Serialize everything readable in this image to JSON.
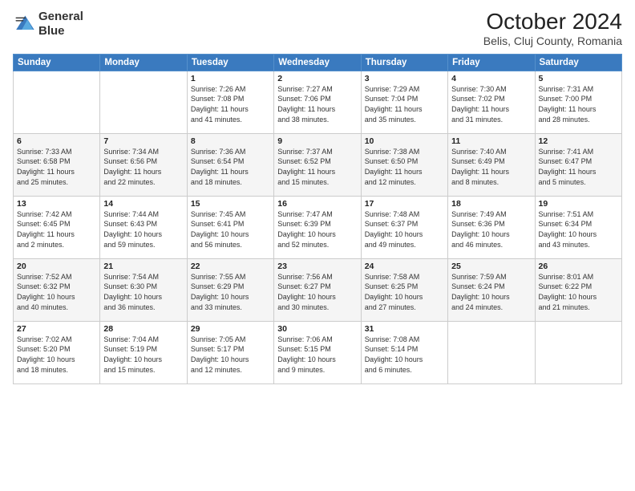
{
  "header": {
    "logo_line1": "General",
    "logo_line2": "Blue",
    "title": "October 2024",
    "subtitle": "Belis, Cluj County, Romania"
  },
  "weekdays": [
    "Sunday",
    "Monday",
    "Tuesday",
    "Wednesday",
    "Thursday",
    "Friday",
    "Saturday"
  ],
  "rows": [
    [
      {
        "num": "",
        "info": ""
      },
      {
        "num": "",
        "info": ""
      },
      {
        "num": "1",
        "info": "Sunrise: 7:26 AM\nSunset: 7:08 PM\nDaylight: 11 hours\nand 41 minutes."
      },
      {
        "num": "2",
        "info": "Sunrise: 7:27 AM\nSunset: 7:06 PM\nDaylight: 11 hours\nand 38 minutes."
      },
      {
        "num": "3",
        "info": "Sunrise: 7:29 AM\nSunset: 7:04 PM\nDaylight: 11 hours\nand 35 minutes."
      },
      {
        "num": "4",
        "info": "Sunrise: 7:30 AM\nSunset: 7:02 PM\nDaylight: 11 hours\nand 31 minutes."
      },
      {
        "num": "5",
        "info": "Sunrise: 7:31 AM\nSunset: 7:00 PM\nDaylight: 11 hours\nand 28 minutes."
      }
    ],
    [
      {
        "num": "6",
        "info": "Sunrise: 7:33 AM\nSunset: 6:58 PM\nDaylight: 11 hours\nand 25 minutes."
      },
      {
        "num": "7",
        "info": "Sunrise: 7:34 AM\nSunset: 6:56 PM\nDaylight: 11 hours\nand 22 minutes."
      },
      {
        "num": "8",
        "info": "Sunrise: 7:36 AM\nSunset: 6:54 PM\nDaylight: 11 hours\nand 18 minutes."
      },
      {
        "num": "9",
        "info": "Sunrise: 7:37 AM\nSunset: 6:52 PM\nDaylight: 11 hours\nand 15 minutes."
      },
      {
        "num": "10",
        "info": "Sunrise: 7:38 AM\nSunset: 6:50 PM\nDaylight: 11 hours\nand 12 minutes."
      },
      {
        "num": "11",
        "info": "Sunrise: 7:40 AM\nSunset: 6:49 PM\nDaylight: 11 hours\nand 8 minutes."
      },
      {
        "num": "12",
        "info": "Sunrise: 7:41 AM\nSunset: 6:47 PM\nDaylight: 11 hours\nand 5 minutes."
      }
    ],
    [
      {
        "num": "13",
        "info": "Sunrise: 7:42 AM\nSunset: 6:45 PM\nDaylight: 11 hours\nand 2 minutes."
      },
      {
        "num": "14",
        "info": "Sunrise: 7:44 AM\nSunset: 6:43 PM\nDaylight: 10 hours\nand 59 minutes."
      },
      {
        "num": "15",
        "info": "Sunrise: 7:45 AM\nSunset: 6:41 PM\nDaylight: 10 hours\nand 56 minutes."
      },
      {
        "num": "16",
        "info": "Sunrise: 7:47 AM\nSunset: 6:39 PM\nDaylight: 10 hours\nand 52 minutes."
      },
      {
        "num": "17",
        "info": "Sunrise: 7:48 AM\nSunset: 6:37 PM\nDaylight: 10 hours\nand 49 minutes."
      },
      {
        "num": "18",
        "info": "Sunrise: 7:49 AM\nSunset: 6:36 PM\nDaylight: 10 hours\nand 46 minutes."
      },
      {
        "num": "19",
        "info": "Sunrise: 7:51 AM\nSunset: 6:34 PM\nDaylight: 10 hours\nand 43 minutes."
      }
    ],
    [
      {
        "num": "20",
        "info": "Sunrise: 7:52 AM\nSunset: 6:32 PM\nDaylight: 10 hours\nand 40 minutes."
      },
      {
        "num": "21",
        "info": "Sunrise: 7:54 AM\nSunset: 6:30 PM\nDaylight: 10 hours\nand 36 minutes."
      },
      {
        "num": "22",
        "info": "Sunrise: 7:55 AM\nSunset: 6:29 PM\nDaylight: 10 hours\nand 33 minutes."
      },
      {
        "num": "23",
        "info": "Sunrise: 7:56 AM\nSunset: 6:27 PM\nDaylight: 10 hours\nand 30 minutes."
      },
      {
        "num": "24",
        "info": "Sunrise: 7:58 AM\nSunset: 6:25 PM\nDaylight: 10 hours\nand 27 minutes."
      },
      {
        "num": "25",
        "info": "Sunrise: 7:59 AM\nSunset: 6:24 PM\nDaylight: 10 hours\nand 24 minutes."
      },
      {
        "num": "26",
        "info": "Sunrise: 8:01 AM\nSunset: 6:22 PM\nDaylight: 10 hours\nand 21 minutes."
      }
    ],
    [
      {
        "num": "27",
        "info": "Sunrise: 7:02 AM\nSunset: 5:20 PM\nDaylight: 10 hours\nand 18 minutes."
      },
      {
        "num": "28",
        "info": "Sunrise: 7:04 AM\nSunset: 5:19 PM\nDaylight: 10 hours\nand 15 minutes."
      },
      {
        "num": "29",
        "info": "Sunrise: 7:05 AM\nSunset: 5:17 PM\nDaylight: 10 hours\nand 12 minutes."
      },
      {
        "num": "30",
        "info": "Sunrise: 7:06 AM\nSunset: 5:15 PM\nDaylight: 10 hours\nand 9 minutes."
      },
      {
        "num": "31",
        "info": "Sunrise: 7:08 AM\nSunset: 5:14 PM\nDaylight: 10 hours\nand 6 minutes."
      },
      {
        "num": "",
        "info": ""
      },
      {
        "num": "",
        "info": ""
      }
    ]
  ]
}
